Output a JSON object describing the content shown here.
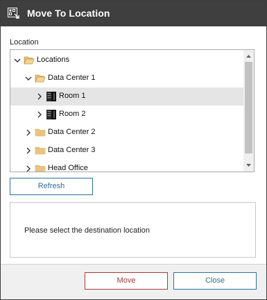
{
  "window": {
    "title": "Move To Location",
    "icon": "move-location-icon"
  },
  "location_label": "Location",
  "tree": {
    "nodes": [
      {
        "label": "Locations",
        "depth": 0,
        "expanded": true,
        "icon": "folder-open-icon",
        "selected": false
      },
      {
        "label": "Data Center 1",
        "depth": 1,
        "expanded": true,
        "icon": "folder-open-icon",
        "selected": false
      },
      {
        "label": "Room 1",
        "depth": 2,
        "expanded": false,
        "icon": "server-rack-icon",
        "selected": true
      },
      {
        "label": "Room 2",
        "depth": 2,
        "expanded": false,
        "icon": "server-rack-icon",
        "selected": false
      },
      {
        "label": "Data Center 2",
        "depth": 1,
        "expanded": false,
        "icon": "folder-icon",
        "selected": false
      },
      {
        "label": "Data Center 3",
        "depth": 1,
        "expanded": false,
        "icon": "folder-icon",
        "selected": false
      },
      {
        "label": "Head Office",
        "depth": 1,
        "expanded": false,
        "icon": "folder-icon",
        "selected": false
      }
    ]
  },
  "refresh_label": "Refresh",
  "message": "Please select the destination location",
  "buttons": {
    "move_label": "Move",
    "close_label": "Close"
  },
  "colors": {
    "titlebar": "#3f3f3f",
    "accent_blue": "#2f6f95",
    "accent_red": "#a33a3a",
    "folder": "#e8c27a",
    "selected_row": "#e5e5e5"
  }
}
